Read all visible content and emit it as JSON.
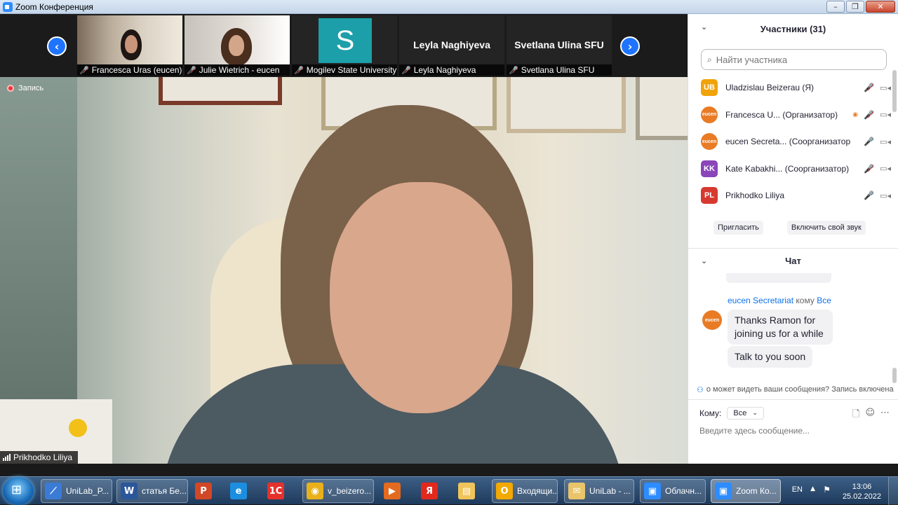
{
  "window": {
    "title": "Zoom Конференция"
  },
  "gallery": {
    "thumbs": [
      {
        "name": "Francesca Uras (eucen)"
      },
      {
        "name": "Julie Wietrich - eucen"
      },
      {
        "name": "Mogilev State University",
        "avatar_letter": "S",
        "avatar_color": "#1c9fa8"
      },
      {
        "name": "Leyla Naghiyeva",
        "display_name": "Leyla Naghiyeva"
      },
      {
        "name": "Svetlana Ulina SFU",
        "display_name": "Svetlana  Ulina  SFU"
      }
    ]
  },
  "main_video": {
    "recording_label": "Запись",
    "speaker_name": "Prikhodko Liliya"
  },
  "participants": {
    "header": "Участники (31)",
    "search_placeholder": "Найти участника",
    "list": [
      {
        "initials": "UB",
        "color": "#f0a30a",
        "name": "Uladzislau  Beizerau (Я)",
        "mic": "muted",
        "video": "off"
      },
      {
        "initials": "eucen",
        "color": "#e97b25",
        "name": "Francesca U... (Организатор)",
        "mic": "muted",
        "video": "off",
        "sharing": true
      },
      {
        "initials": "eucen",
        "color": "#e97b25",
        "name": "eucen Secreta... (Соорганизатор)",
        "mic": "on",
        "video": "off"
      },
      {
        "initials": "KK",
        "color": "#8a46b8",
        "name": "Kate Kabakhi... (Соорганизатор)",
        "mic": "muted",
        "video": "off"
      },
      {
        "initials": "PL",
        "color": "#d63a2f",
        "name": "Prikhodko Liliya",
        "mic": "on",
        "video": "off"
      }
    ],
    "invite_label": "Пригласить",
    "unmute_label": "Включить свой звук"
  },
  "chat": {
    "header": "Чат",
    "message": {
      "from": "eucen Secretariat",
      "to_word": "кому",
      "to": "Все",
      "lines": [
        "Thanks Ramon for joining us for a while",
        "Talk to you soon"
      ]
    },
    "privacy_note": "о может видеть ваши сообщения? Запись включена",
    "to_label": "Кому:",
    "recipient": "Все",
    "input_placeholder": "Введите здесь сообщение..."
  },
  "taskbar": {
    "items": [
      {
        "label": "UniLab_P...",
        "color": "#3a7bd5",
        "glyph": "⟋"
      },
      {
        "label": "статья Бе...",
        "color": "#2b579a",
        "glyph": "W"
      },
      {
        "label": "",
        "color": "#d24726",
        "glyph": "P"
      },
      {
        "label": "",
        "color": "#1b8ee0",
        "glyph": "e"
      },
      {
        "label": "",
        "color": "#e5312c",
        "glyph": "1С"
      },
      {
        "label": "v_beizero...",
        "color": "#e8b11b",
        "glyph": "◉"
      },
      {
        "label": "",
        "color": "#e36b1f",
        "glyph": "▶"
      },
      {
        "label": "",
        "color": "#e3281c",
        "glyph": "Я"
      },
      {
        "label": "",
        "color": "#f0c45a",
        "glyph": "▤"
      },
      {
        "label": "Входящи...",
        "color": "#f2a900",
        "glyph": "O"
      },
      {
        "label": "UniLab - ...",
        "color": "#e9c46a",
        "glyph": "✉"
      },
      {
        "label": "Облачн...",
        "color": "#2d8cff",
        "glyph": "▣"
      },
      {
        "label": "Zoom Ко...",
        "color": "#2d8cff",
        "glyph": "▣"
      }
    ],
    "lang": "EN",
    "time": "13:06",
    "date": "25.02.2022"
  }
}
